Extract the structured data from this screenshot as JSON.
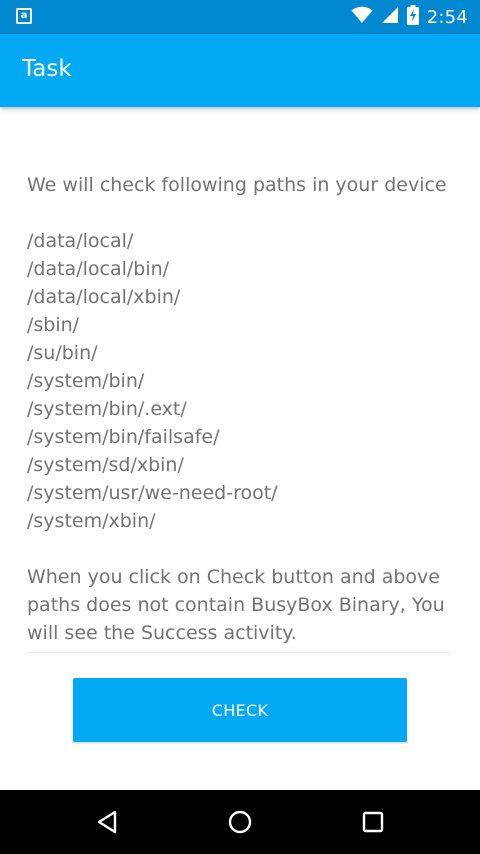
{
  "status_bar": {
    "time": "2:54",
    "notification_icon": "a",
    "icons": [
      "notification-icon",
      "wifi-icon",
      "signal-icon",
      "battery-charging-icon"
    ]
  },
  "app_bar": {
    "title": "Task"
  },
  "content": {
    "intro": "We will check following paths in your device",
    "paths": [
      "/data/local/",
      "/data/local/bin/",
      "/data/local/xbin/",
      "/sbin/",
      "/su/bin/",
      "/system/bin/",
      "/system/bin/.ext/",
      "/system/bin/failsafe/",
      "/system/sd/xbin/",
      "/system/usr/we-need-root/",
      "/system/xbin/"
    ],
    "outro": "When you click on Check button and above paths does not contain BusyBox Binary, You will see the Success activity."
  },
  "check_button": {
    "label": "CHECK"
  },
  "nav_bar": {
    "icons": [
      "back-icon",
      "home-icon",
      "recents-icon"
    ]
  },
  "colors": {
    "status_bar": "#0288d1",
    "app_bar": "#03a9f4",
    "accent": "#03a9f4",
    "body_text": "#737373",
    "nav_bar": "#000000"
  }
}
